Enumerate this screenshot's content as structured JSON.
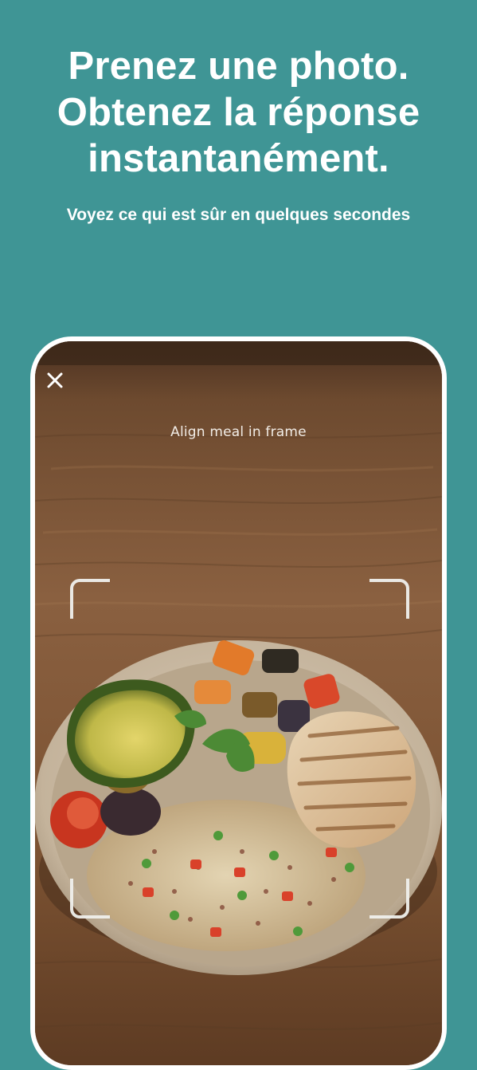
{
  "onboarding": {
    "headline_line1": "Prenez une photo.",
    "headline_line2": "Obtenez la réponse",
    "headline_line3": "instantanément.",
    "subheadline": "Voyez ce qui est sûr en quelques secondes"
  },
  "camera": {
    "close_icon": "close-icon",
    "hint": "Align meal in frame",
    "scene_description_icon": "food-bowl-photo"
  },
  "colors": {
    "background": "#3f9595",
    "text": "#ffffff",
    "frame_border": "#ffffff"
  }
}
